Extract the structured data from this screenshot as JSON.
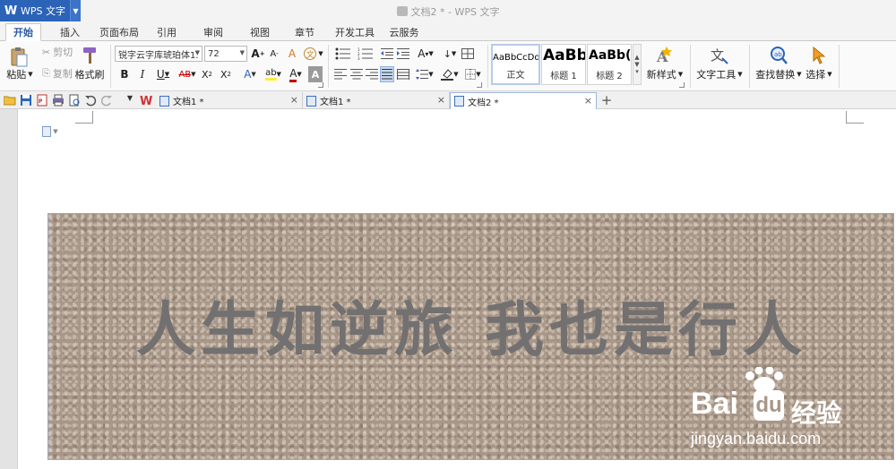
{
  "app": {
    "name": "WPS 文字",
    "logo": "W",
    "window_title": "文档2 * - WPS 文字"
  },
  "tabs": [
    "开始",
    "插入",
    "页面布局",
    "引用",
    "审阅",
    "视图",
    "章节",
    "开发工具",
    "云服务"
  ],
  "clipboard": {
    "paste": "粘贴",
    "cut": "剪切",
    "copy": "复制",
    "format_painter": "格式刷"
  },
  "font": {
    "family": "锐字云字库琥珀体1.",
    "size": "72"
  },
  "styles": [
    {
      "sample": "AaBbCcDd",
      "name": "正文"
    },
    {
      "sample": "AaBb",
      "name": "标题 1"
    },
    {
      "sample": "AaBb(",
      "name": "标题 2"
    }
  ],
  "buttons": {
    "new_style": "新样式",
    "text_tools": "文字工具",
    "find_replace": "查找替换",
    "select": "选择"
  },
  "doc_tabs": [
    {
      "label": "文档1 *",
      "active": false
    },
    {
      "label": "文档1 *",
      "active": false
    },
    {
      "label": "文档2 *",
      "active": true
    }
  ],
  "document": {
    "banner_text": "人生如逆旅 我也是行人"
  },
  "watermark": {
    "brand": "Bai",
    "cn": "经验",
    "url": "jingyan.baidu.com"
  },
  "colors": {
    "accent": "#2b63b8",
    "banner_bg": "#a89788",
    "banner_text": "#727070",
    "font_color_swatch": "#c00000"
  }
}
